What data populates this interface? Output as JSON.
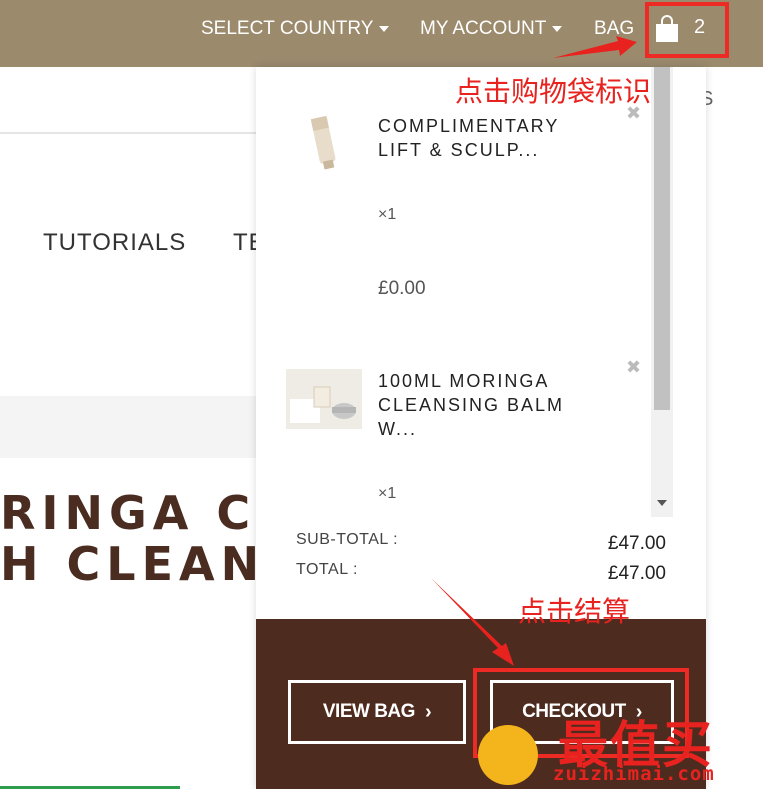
{
  "topbar": {
    "select_country": "SELECT COUNTRY",
    "my_account": "MY ACCOUNT",
    "bag_label": "BAG",
    "bag_count": "2"
  },
  "background": {
    "nav_tutorials": "TUTORIALS",
    "nav_partial": "TE",
    "title_line1": "RINGA CL",
    "title_line2": "H CLEAN",
    "partial_s": "S"
  },
  "bag": {
    "items": [
      {
        "name": "COMPLIMENTARY\nLIFT & SCULP...",
        "qty": "×1",
        "price": "£0.00"
      },
      {
        "name": "100ML MORINGA\nCLEANSING BALM\nW...",
        "qty": "×1",
        "price": ""
      }
    ],
    "subtotal_label": "SUB-TOTAL :",
    "subtotal_value": "£47.00",
    "total_label": "TOTAL :",
    "total_value": "£47.00",
    "view_bag": "VIEW BAG",
    "checkout": "CHECKOUT"
  },
  "annotations": {
    "click_bag": "点击购物袋标识",
    "click_checkout": "点击结算"
  },
  "watermark": {
    "cn": "最值买",
    "en": "zuizhimai.com"
  },
  "colors": {
    "topbar": "#9b8a6c",
    "footer": "#4e2b1f",
    "annotation": "#e8231f"
  }
}
